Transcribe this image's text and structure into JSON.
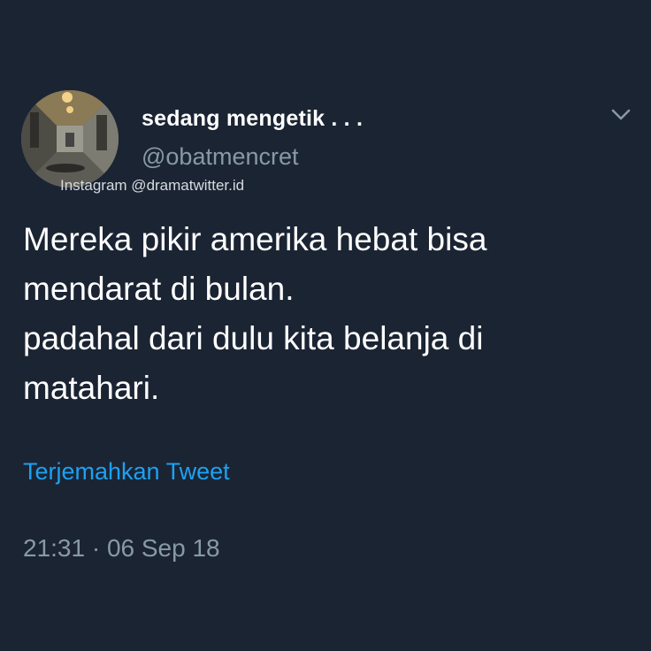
{
  "author": {
    "display_name": "sedang mengetik . . .",
    "handle": "@obatmencret"
  },
  "watermark": "Instagram @dramatwitter.id",
  "tweet": {
    "lines": [
      "Mereka pikir amerika hebat bisa",
      "mendarat di bulan.",
      "padahal dari dulu kita belanja di",
      "matahari."
    ]
  },
  "translate_label": "Terjemahkan Tweet",
  "timestamp": "21:31 · 06 Sep 18",
  "icons": {
    "menu": "chevron-down-icon"
  },
  "colors": {
    "background": "#1b2433",
    "text_primary": "#ffffff",
    "text_secondary": "#8899a6",
    "link": "#1da1f2"
  }
}
